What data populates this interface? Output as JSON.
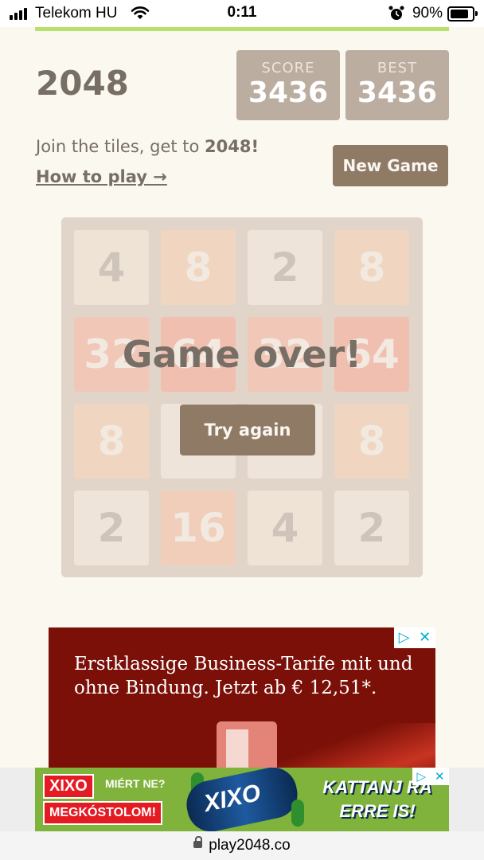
{
  "status_bar": {
    "carrier": "Telekom HU",
    "time": "0:11",
    "battery": "90%"
  },
  "game": {
    "title": "2048",
    "score_label": "SCORE",
    "score": "3436",
    "best_label": "BEST",
    "best": "3436",
    "intro_text": "Join the tiles, get to ",
    "intro_bold": "2048!",
    "how_to_play": "How to play →",
    "new_game": "New Game",
    "game_over": "Game over!",
    "try_again": "Try again",
    "board": [
      [
        "4",
        "8",
        "2",
        "8"
      ],
      [
        "32",
        "64",
        "32",
        "64"
      ],
      [
        "8",
        "2",
        "2",
        "8"
      ],
      [
        "2",
        "16",
        "4",
        "2"
      ]
    ]
  },
  "ad": {
    "text": "Erstklassige Business-Tarife mit und ohne Bindung. Jetzt ab € 12,51*.",
    "adchoices_icon": "adchoices-icon",
    "close_icon": "close-icon"
  },
  "banner": {
    "brand": "XIXO",
    "tagline": "MIÉRT NE?",
    "cta": "MEGKÓSTOLOM!",
    "can_text": "XIXO",
    "headline_1": "KATTANJ RÁ",
    "headline_2": "ERRE IS!"
  },
  "url_bar": {
    "url": "play2048.co"
  },
  "colors": {
    "background": "#faf8ef",
    "board": "#bbada0",
    "button": "#8f7a66",
    "ad_bg": "#7a1008",
    "banner_bg": "#7fb33b"
  }
}
